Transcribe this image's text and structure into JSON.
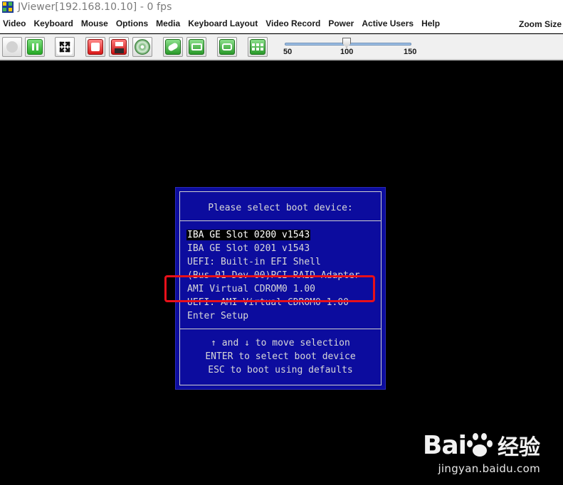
{
  "window": {
    "title": "JViewer[192.168.10.10] - 0 fps"
  },
  "menubar": {
    "items": [
      "Video",
      "Keyboard",
      "Mouse",
      "Options",
      "Media",
      "Keyboard Layout",
      "Video Record",
      "Power",
      "Active Users",
      "Help"
    ],
    "zoom_label": "Zoom Size"
  },
  "toolbar": {
    "buttons": [
      {
        "name": "play-icon-disabled"
      },
      {
        "name": "pause-icon"
      },
      {
        "name": "fullscreen-icon"
      },
      {
        "name": "stop-icon"
      },
      {
        "name": "floppy-icon"
      },
      {
        "name": "cd-icon"
      },
      {
        "name": "mouse-icon"
      },
      {
        "name": "keyboard-icon"
      },
      {
        "name": "video-record-icon"
      },
      {
        "name": "active-users-icon"
      }
    ],
    "zoom": {
      "min_label": "50",
      "mid_label": "100",
      "max_label": "150",
      "value": 100
    }
  },
  "boot_menu": {
    "title": "Please select boot device:",
    "items": [
      "IBA GE Slot 0200 v1543",
      "IBA GE Slot 0201 v1543",
      "UEFI: Built-in EFI Shell",
      "(Bus 01 Dev 00)PCI RAID Adapter",
      "AMI Virtual CDROM0 1.00",
      "UEFI: AMI Virtual CDROM0 1.00",
      "Enter Setup"
    ],
    "selected_index": 0,
    "help": [
      "↑ and ↓ to move selection",
      "ENTER to select boot device",
      "ESC to boot using defaults"
    ]
  },
  "watermark": {
    "brand_left": "Bai",
    "brand_right": "经验",
    "url": "jingyan.baidu.com"
  },
  "colors": {
    "boot_bg": "#0c0c9e",
    "highlight": "#e8101a"
  }
}
